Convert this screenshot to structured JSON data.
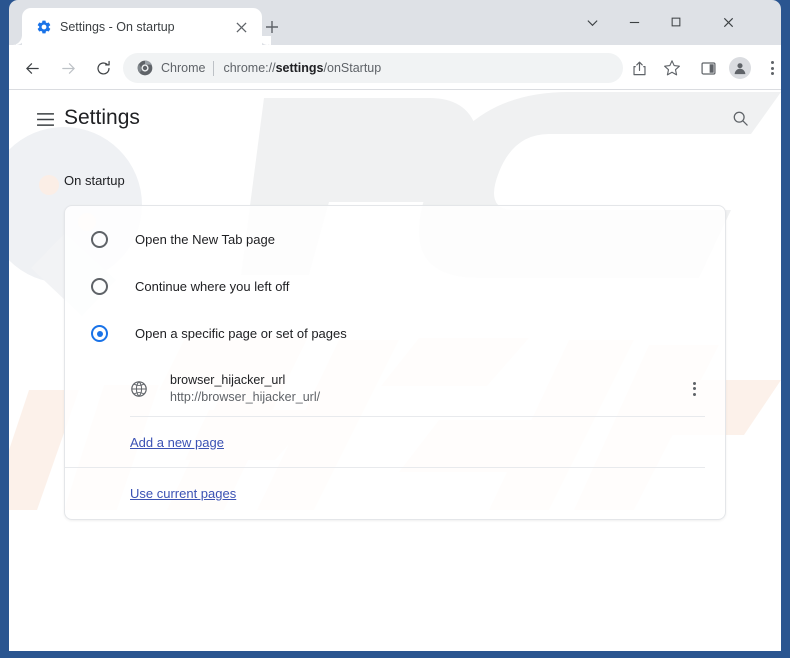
{
  "window": {
    "controls": {
      "tab_search": "chevron-down-icon",
      "minimize": "minimize-icon",
      "maximize": "maximize-icon",
      "close": "close-icon"
    },
    "frame_color": "#2a5590"
  },
  "tabstrip": {
    "active_tab": {
      "title": "Settings - On startup",
      "favicon": "settings-gear-icon",
      "close_label": "×"
    },
    "new_tab_label": "+"
  },
  "toolbar": {
    "back_icon": "back-arrow-icon",
    "forward_icon": "forward-arrow-icon",
    "reload_icon": "reload-icon",
    "omnibox": {
      "scheme_label": "Chrome",
      "url_prefix": "chrome://",
      "url_bold": "settings",
      "url_suffix": "/onStartup",
      "full_url": "chrome://settings/onStartup",
      "favicon": "chrome-logo-icon"
    },
    "actions": [
      {
        "name": "share-button",
        "icon": "share-icon"
      },
      {
        "name": "bookmark-button",
        "icon": "star-icon"
      },
      {
        "name": "side-panel-button",
        "icon": "side-panel-icon"
      },
      {
        "name": "profile-button",
        "icon": "person-avatar-icon"
      },
      {
        "name": "chrome-menu-button",
        "icon": "three-dot-menu-icon"
      }
    ]
  },
  "settings": {
    "menu_icon": "hamburger-menu-icon",
    "title": "Settings",
    "search_icon": "search-icon",
    "section_label": "On startup",
    "accent_color": "#1a73e8",
    "link_color": "#3b52b4",
    "options": [
      {
        "label": "Open the New Tab page",
        "selected": false
      },
      {
        "label": "Continue where you left off",
        "selected": false
      },
      {
        "label": "Open a specific page or set of pages",
        "selected": true
      }
    ],
    "startup_pages": [
      {
        "title": "browser_hijacker_url",
        "url": "http://browser_hijacker_url/",
        "favicon": "globe-icon",
        "menu_icon": "three-dot-menu-icon"
      }
    ],
    "links": [
      {
        "label": "Add a new page",
        "name": "add-a-new-page-link"
      },
      {
        "label": "Use current pages",
        "name": "use-current-pages-link"
      }
    ]
  },
  "watermark": {
    "primary_text": "PC",
    "secondary_text": "risk.com",
    "primary_color": "#f0f1f2",
    "secondary_color": "#fbeee6"
  }
}
